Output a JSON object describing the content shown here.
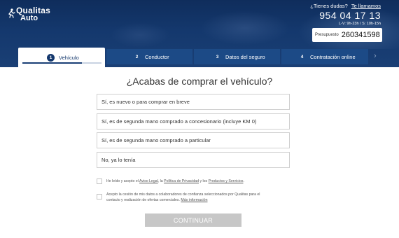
{
  "header": {
    "brand_line1": "Qualitas",
    "brand_line2": "Auto",
    "question_text": "¿Tienes dudas?",
    "call_link": "Te llamamos",
    "phone": "954 04 17 13",
    "hours": "L-V: 9h-23h / S: 10h-15h",
    "budget_label": "Presupuesto",
    "budget_number": "260341598"
  },
  "steps": [
    {
      "number": "1",
      "label": "Vehículo",
      "active": true,
      "progress": 0.75
    },
    {
      "number": "2",
      "label": "Conductor"
    },
    {
      "number": "3",
      "label": "Datos del seguro"
    },
    {
      "number": "4",
      "label": "Contratación online"
    }
  ],
  "main": {
    "question": "¿Acabas de comprar el vehículo?",
    "options": [
      "Sí, es nuevo o para comprar en breve",
      "Sí, es de segunda mano comprado a concesionario (incluye KM 0)",
      "Sí, es de segunda mano comprado a particular",
      "No, ya lo tenía"
    ]
  },
  "legal": {
    "accept_prefix": "He leído y acepto el",
    "aviso_legal": "Aviso Legal",
    "sep1": ", la",
    "privacidad": "Política de Privacidad",
    "sep2": "y los",
    "productos": "Productos y Servicios",
    "end": ".",
    "consent_text": "Acepto la cesión de mis datos a colaboradores de confianza seleccionados por Qualitas para el contacto y realización de ofertas comerciales.",
    "more_info": "Más información"
  },
  "cta": {
    "continue_label": "CONTINUAR"
  },
  "colors": {
    "header_bg": "#14386d",
    "step_inactive": "#1c4a86",
    "button_disabled": "#c7c7c7"
  }
}
